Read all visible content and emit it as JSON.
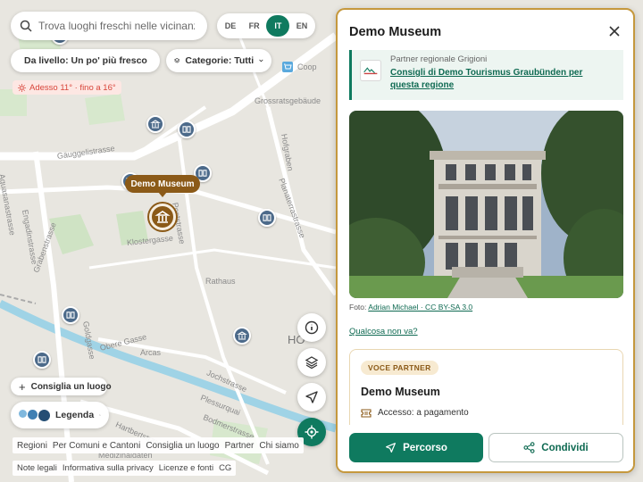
{
  "search": {
    "placeholder": "Trova luoghi freschi nelle vicinanze"
  },
  "languages": [
    {
      "code": "DE",
      "active": false
    },
    {
      "code": "FR",
      "active": false
    },
    {
      "code": "IT",
      "active": true
    },
    {
      "code": "EN",
      "active": false
    }
  ],
  "filters": {
    "level": "Da livello: Un po' più fresco",
    "categories": "Categorie: Tutti"
  },
  "temperature": "Adesso 11° · fino a 16°",
  "map": {
    "streets": [
      "Gäuggelistrasse",
      "Aquasanastrasse",
      "Engadinstrasse",
      "Grabenstrasse",
      "Klostergasse",
      "Poststrasse",
      "Planaterrastrasse",
      "Hofgraben",
      "Grossratsgebäude",
      "Rathaus",
      "Obere Gasse",
      "Arcas",
      "Jochstrasse",
      "Plessurquai",
      "Bodmerstrasse",
      "Hartbertstrasse",
      "Medizinaldaten",
      "Coop",
      "Goldgasse",
      "HO"
    ],
    "selected_label": "Demo Museum"
  },
  "controls": {
    "suggest": "Consiglia un luogo",
    "legend": "Legenda"
  },
  "footer": {
    "nav": [
      "Regioni",
      "Per Comuni e Cantoni",
      "Consiglia un luogo",
      "Partner",
      "Chi siamo"
    ],
    "legal": [
      "Note legali",
      "Informativa sulla privacy",
      "Licenze e fonti",
      "CG"
    ]
  },
  "panel": {
    "title": "Demo Museum",
    "partner_sub": "Partner regionale Grigioni",
    "partner_link": "Consigli di Demo Tourismus Graubünden per questa regione",
    "photo_credit_prefix": "Foto:",
    "photo_credit": "Adrian Michael · CC BY-SA 3.0",
    "question_link": "Qualcosa non va?",
    "badge": "VOCE PARTNER",
    "card_title": "Demo Museum",
    "access": "Accesso: a pagamento",
    "route_button": "Percorso",
    "share_button": "Condividi"
  },
  "colors": {
    "brand_green": "#0f7a5f",
    "museum_brown": "#8b5a18",
    "poi_blue": "#4c6a8a",
    "temp_red": "#d8453a"
  }
}
